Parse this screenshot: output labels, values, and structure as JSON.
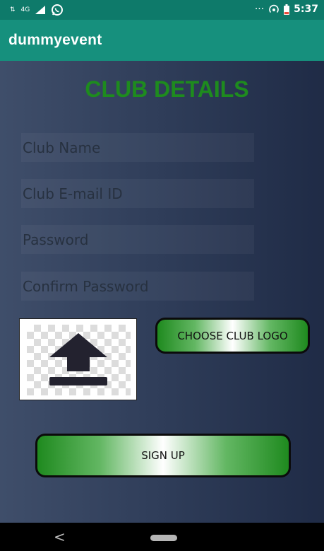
{
  "status_bar": {
    "network": "4G",
    "time": "5:37",
    "more": "···"
  },
  "app_bar": {
    "title": "dummyevent"
  },
  "form": {
    "title": "CLUB DETAILS",
    "club_name_placeholder": "Club Name",
    "club_email_placeholder": "Club E-mail ID",
    "password_placeholder": "Password",
    "confirm_password_placeholder": "Confirm Password",
    "choose_logo_label": "CHOOSE CLUB LOGO",
    "sign_up_label": "SIGN UP"
  },
  "nav": {
    "back_icon": "<"
  },
  "colors": {
    "status_bar": "#0e7a6a",
    "app_bar": "#16907d",
    "title_green": "#1e8b1e",
    "background": "#2f3d59"
  }
}
